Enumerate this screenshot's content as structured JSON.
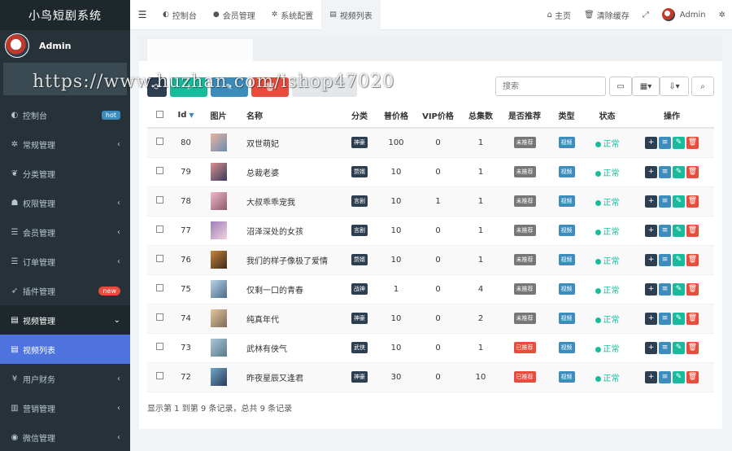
{
  "app": {
    "title": "小鸟短剧系统"
  },
  "user": {
    "name": "Admin"
  },
  "sidebar": {
    "items": [
      {
        "label": "控制台",
        "icon": "dashboard-icon",
        "badge": "hot"
      },
      {
        "label": "常规管理",
        "icon": "cogs-icon",
        "chevron": "‹"
      },
      {
        "label": "分类管理",
        "icon": "leaf-icon"
      },
      {
        "label": "权限管理",
        "icon": "group-icon",
        "chevron": "‹"
      },
      {
        "label": "会员管理",
        "icon": "list-icon",
        "chevron": "‹"
      },
      {
        "label": "订单管理",
        "icon": "list-icon",
        "chevron": "‹"
      },
      {
        "label": "插件管理",
        "icon": "rocket-icon",
        "badge": "new"
      },
      {
        "label": "视频管理",
        "icon": "file-icon",
        "chevron": "⌄"
      },
      {
        "label": "视频列表",
        "icon": "file-icon"
      },
      {
        "label": "用户财务",
        "icon": "yen-icon",
        "chevron": "‹"
      },
      {
        "label": "营销管理",
        "icon": "bar-chart-icon",
        "chevron": "‹"
      },
      {
        "label": "微信管理",
        "icon": "wechat-icon",
        "chevron": "‹"
      }
    ]
  },
  "navbar": {
    "tabs": [
      {
        "label": "控制台",
        "icon": "dashboard-icon"
      },
      {
        "label": "会员管理",
        "icon": "user-icon"
      },
      {
        "label": "系统配置",
        "icon": "cog-icon"
      },
      {
        "label": "视频列表",
        "icon": "file-icon"
      }
    ],
    "home": "主页",
    "clear_cache": "清除缓存",
    "admin": "Admin"
  },
  "toolbar": {
    "search_placeholder": "搜索"
  },
  "watermark": "https://www.huzhan.com/ishop47020",
  "table": {
    "headers": {
      "id": "Id",
      "image": "图片",
      "name": "名称",
      "category": "分类",
      "price": "普价格",
      "vip_price": "VIP价格",
      "episodes": "总集数",
      "recommended": "是否推荐",
      "type": "类型",
      "status": "状态",
      "actions": "操作"
    },
    "rows": [
      {
        "id": "80",
        "name": "双世萌妃",
        "category": "神豪",
        "price": "100",
        "vip": "0",
        "episodes": "1",
        "rec": "未推荐",
        "type": "视频",
        "status": "正常"
      },
      {
        "id": "79",
        "name": "总裁老婆",
        "category": "赘婿",
        "price": "10",
        "vip": "0",
        "episodes": "1",
        "rec": "未推荐",
        "type": "视频",
        "status": "正常"
      },
      {
        "id": "78",
        "name": "大叔乖乖宠我",
        "category": "言剧",
        "price": "10",
        "vip": "1",
        "episodes": "1",
        "rec": "未推荐",
        "type": "视频",
        "status": "正常"
      },
      {
        "id": "77",
        "name": "沼泽深处的女孩",
        "category": "言剧",
        "price": "10",
        "vip": "0",
        "episodes": "1",
        "rec": "未推荐",
        "type": "视频",
        "status": "正常"
      },
      {
        "id": "76",
        "name": "我们的样子像极了爱情",
        "category": "赘婿",
        "price": "10",
        "vip": "0",
        "episodes": "1",
        "rec": "未推荐",
        "type": "视频",
        "status": "正常"
      },
      {
        "id": "75",
        "name": "仅剩一口的青春",
        "category": "战神",
        "price": "1",
        "vip": "0",
        "episodes": "4",
        "rec": "未推荐",
        "type": "视频",
        "status": "正常"
      },
      {
        "id": "74",
        "name": "纯真年代",
        "category": "神豪",
        "price": "10",
        "vip": "0",
        "episodes": "2",
        "rec": "未推荐",
        "type": "视频",
        "status": "正常"
      },
      {
        "id": "73",
        "name": "武林有侠气",
        "category": "武侠",
        "price": "10",
        "vip": "0",
        "episodes": "1",
        "rec": "已推荐",
        "type": "视频",
        "status": "正常"
      },
      {
        "id": "72",
        "name": "昨夜星辰又逢君",
        "category": "神豪",
        "price": "30",
        "vip": "0",
        "episodes": "10",
        "rec": "已推荐",
        "type": "视频",
        "status": "正常"
      }
    ]
  },
  "footer": {
    "summary": "显示第 1 到第 9 条记录，总共 9 条记录"
  },
  "colors": {
    "sidebar_bg": "#263238",
    "active": "#4e73df",
    "success": "#18bc9c",
    "danger": "#e74c3c",
    "info": "#3c8dbc"
  }
}
